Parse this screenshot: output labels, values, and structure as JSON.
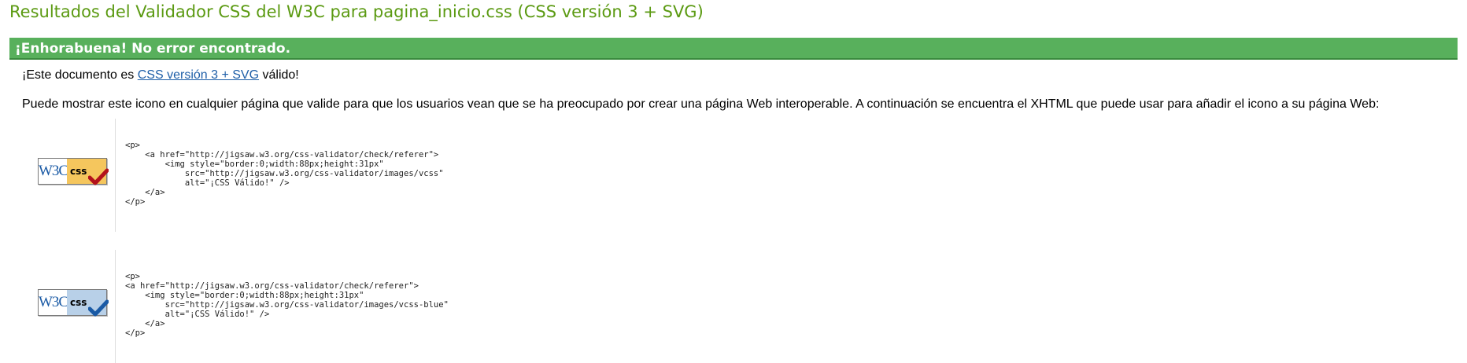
{
  "header": {
    "title": "Resultados del Validador CSS del W3C para pagina_inicio.css (CSS versión 3 + SVG)"
  },
  "congrats": {
    "text": "¡Enhorabuena! No error encontrado."
  },
  "validity": {
    "prefix": "¡Este documento es ",
    "link_label": "CSS versión 3 + SVG",
    "suffix": " válido!"
  },
  "info": {
    "text": "Puede mostrar este icono en cualquier página que valide para que los usuarios vean que se ha preocupado por crear una página Web interoperable. A continuación se encuentra el XHTML que puede usar para añadir el icono a su página Web:"
  },
  "badges": [
    {
      "w3c_text": "W3C",
      "css_text": "css",
      "icon": "check-icon",
      "accent": "#f5c65d",
      "check_color": "#b3121b",
      "code": "<p>\n    <a href=\"http://jigsaw.w3.org/css-validator/check/referer\">\n        <img style=\"border:0;width:88px;height:31px\"\n            src=\"http://jigsaw.w3.org/css-validator/images/vcss\"\n            alt=\"¡CSS Válido!\" />\n    </a>\n</p>"
    },
    {
      "w3c_text": "W3C",
      "css_text": "css",
      "icon": "check-icon",
      "accent": "#b8d0e8",
      "check_color": "#1a5aa5",
      "code": "<p>\n<a href=\"http://jigsaw.w3.org/css-validator/check/referer\">\n    <img style=\"border:0;width:88px;height:31px\"\n        src=\"http://jigsaw.w3.org/css-validator/images/vcss-blue\"\n        alt=\"¡CSS Válido!\" />\n    </a>\n</p>"
    }
  ]
}
